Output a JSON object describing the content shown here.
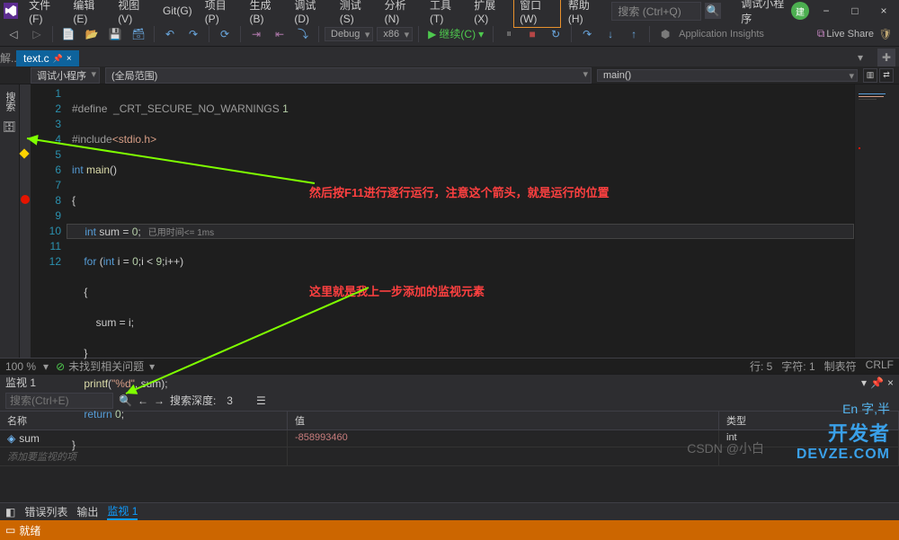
{
  "menu": {
    "items": [
      "文件(F)",
      "编辑(E)",
      "视图(V)",
      "Git(G)",
      "项目(P)",
      "生成(B)",
      "调试(D)",
      "测试(S)",
      "分析(N)",
      "工具(T)",
      "扩展(X)",
      "窗口(W)",
      "帮助(H)"
    ],
    "search_ph": "搜索 (Ctrl+Q)",
    "title": "调试小程序",
    "avatar": "建",
    "min": "−",
    "max": "□",
    "close": "×"
  },
  "toolbar": {
    "config": "Debug",
    "platform": "x86",
    "run": "继续(C)",
    "insights": "Application Insights",
    "live": "Live Share"
  },
  "tabs": {
    "left": "解...",
    "search_v": "搜索",
    "file": "text.c"
  },
  "breadcrumb": {
    "left": "调试小程序",
    "mid": "(全局范围)",
    "right": "main()"
  },
  "code": {
    "lines": [
      "#define  _CRT_SECURE_NO_WARNINGS 1",
      "#include<stdio.h>",
      "int main()",
      "{",
      "    int sum = 0;",
      "    for (int i = 0;i < 9;i++)",
      "    {",
      "        sum = i;",
      "    }",
      "    printf(\"%d\", sum);",
      "    return 0;",
      "}"
    ],
    "perf": "已用时间<= 1ms"
  },
  "annotations": {
    "a1": "然后按F11进行逐行运行，注意这个箭头，就是运行的位置",
    "a2": "这里就是我上一步添加的监视元素"
  },
  "status": {
    "zoom": "100 %",
    "issues": "未找到相关问题",
    "pos": "行: 5",
    "char": "字符: 1",
    "tab": "制表符",
    "crlf": "CRLF"
  },
  "watch": {
    "title": "监视 1",
    "search_ph": "搜索(Ctrl+E)",
    "depth_lbl": "搜索深度:",
    "depth": "3",
    "cols": [
      "名称",
      "值",
      "类型"
    ],
    "row": {
      "name": "sum",
      "value": "-858993460",
      "type": "int"
    },
    "add": "添加要监视的项"
  },
  "bottom": {
    "errs": "错误列表",
    "out": "输出",
    "watch": "监视 1",
    "ready": "就绪"
  },
  "wm": {
    "l1": "En 字,半",
    "l2": "开发者",
    "l3": "DEVZE.COM",
    "csdn": "CSDN @小白"
  }
}
